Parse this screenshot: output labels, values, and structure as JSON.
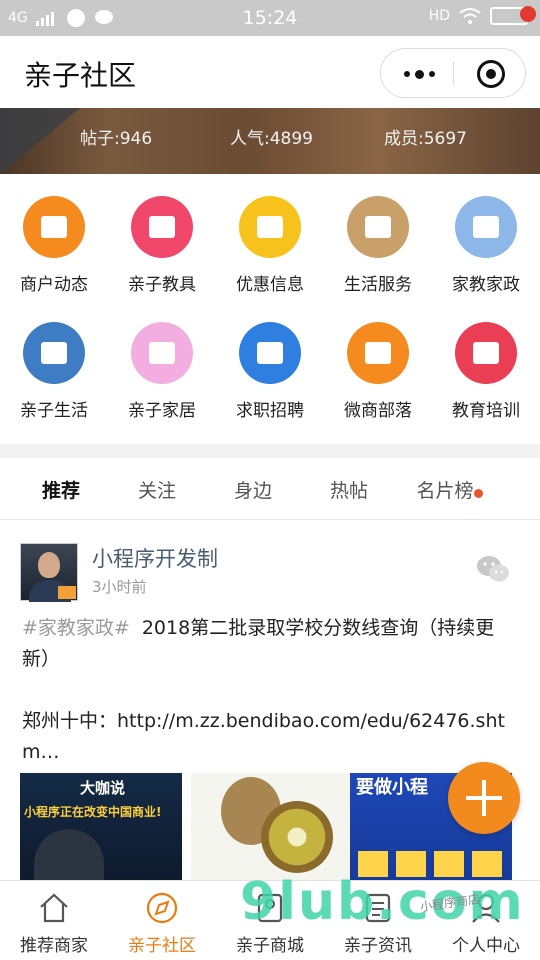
{
  "status_bar": {
    "network": "4G",
    "time": "15:24",
    "hd": "HD"
  },
  "title_bar": {
    "title": "亲子社区"
  },
  "banner": {
    "posts": "帖子:946",
    "popularity": "人气:4899",
    "members": "成员:5697"
  },
  "categories": [
    {
      "label": "商户动态",
      "icon": "store-icon",
      "color": "#f58a1f"
    },
    {
      "label": "亲子教具",
      "icon": "paint-roller-icon",
      "color": "#f0476a"
    },
    {
      "label": "优惠信息",
      "icon": "shopping-bag-icon",
      "color": "#f7c21c"
    },
    {
      "label": "生活服务",
      "icon": "clover-icon",
      "color": "#c9a06a"
    },
    {
      "label": "家教家政",
      "icon": "cartoon-icon",
      "color": "#8cb7e8"
    },
    {
      "label": "亲子生活",
      "icon": "island-icon",
      "color": "#3e7cc4"
    },
    {
      "label": "亲子家居",
      "icon": "stroller-icon",
      "color": "#f2aee0"
    },
    {
      "label": "求职招聘",
      "icon": "briefcase-icon",
      "color": "#2f7fe0"
    },
    {
      "label": "微商部落",
      "icon": "chat-bubble-icon",
      "color": "#f58a1f"
    },
    {
      "label": "教育培训",
      "icon": "books-icon",
      "color": "#ea3e55"
    }
  ],
  "tabs": [
    {
      "label": "推荐",
      "active": true
    },
    {
      "label": "关注"
    },
    {
      "label": "身边"
    },
    {
      "label": "热帖"
    },
    {
      "label": "名片榜",
      "has_dot": true
    }
  ],
  "post": {
    "author": "小程序开发制",
    "time": "3小时前",
    "topic": "#家教家政#",
    "title": "2018第二批录取学校分数线查询（持续更新）",
    "body": "郑州十中：http://m.zz.bendibao.com/edu/62476.shtm…",
    "images": [
      {
        "caption": "大咖说",
        "subcaption": "小程序正在改变中国商业!"
      },
      {
        "caption": ""
      },
      {
        "caption": "要做小程"
      }
    ]
  },
  "bottom_nav": [
    {
      "label": "推荐商家",
      "icon": "home-icon"
    },
    {
      "label": "亲子社区",
      "icon": "compass-icon",
      "active": true
    },
    {
      "label": "亲子商城",
      "icon": "shop-icon"
    },
    {
      "label": "亲子资讯",
      "icon": "news-icon"
    },
    {
      "label": "个人中心",
      "icon": "user-icon"
    }
  ],
  "watermark": {
    "main": "9lub.com",
    "small": "小程序商店"
  }
}
